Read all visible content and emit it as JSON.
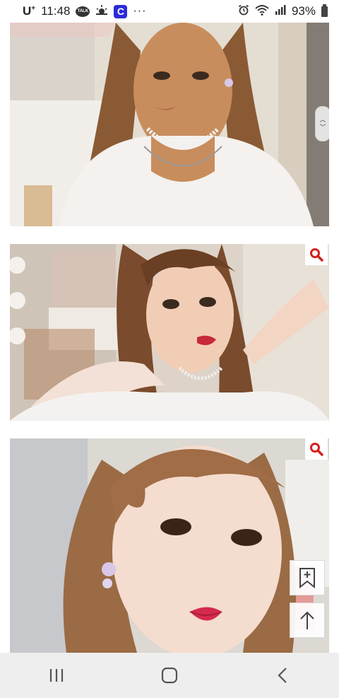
{
  "status_bar": {
    "carrier": "U",
    "carrier_sup": "+",
    "time": "11:48",
    "talk_icon_label": "TALK",
    "c_icon_label": "C",
    "more": "···",
    "battery_percent": "93%",
    "icons": [
      "talk-icon",
      "weather-icon",
      "c-app-icon",
      "alarm-icon",
      "wifi-icon",
      "signal-icon",
      "battery-icon"
    ]
  },
  "photos": [
    {
      "name": "photo-before-makeup",
      "has_zoom_button": false
    },
    {
      "name": "photo-makeup-pose",
      "has_zoom_button": true
    },
    {
      "name": "photo-makeup-closeup",
      "has_zoom_button": true
    }
  ],
  "floating_buttons": {
    "bookmark_icon": "bookmark-plus-icon",
    "top_icon": "arrow-up-icon",
    "zoom_icon": "magnifier-icon"
  },
  "nav_bar": {
    "icons": [
      "recent-apps-icon",
      "home-icon",
      "back-icon"
    ]
  },
  "colors": {
    "accent_red": "#d61f1f",
    "navbar_bg": "#eeeeee"
  }
}
